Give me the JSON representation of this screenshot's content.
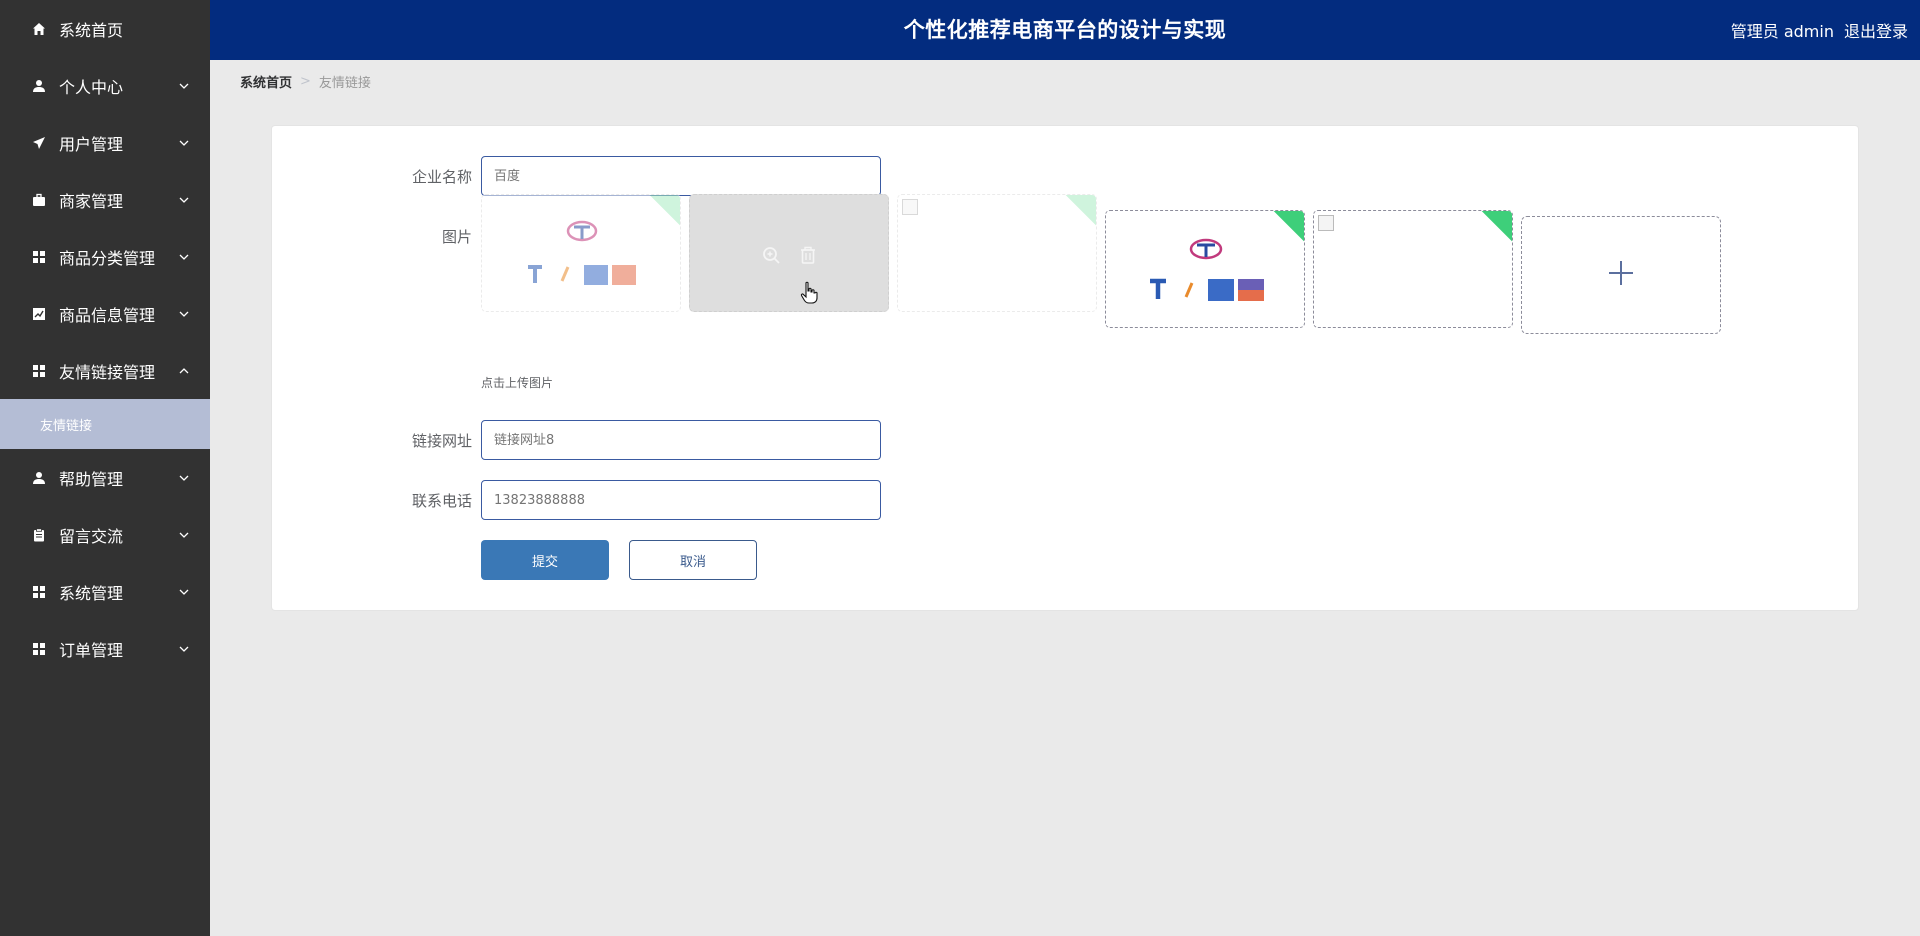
{
  "header": {
    "title": "个性化推荐电商平台的设计与实现",
    "user": "管理员 admin",
    "logout": "退出登录"
  },
  "sidebar": {
    "items": [
      {
        "label": "系统首页",
        "icon": "home-icon"
      },
      {
        "label": "个人中心",
        "icon": "user-icon"
      },
      {
        "label": "用户管理",
        "icon": "send-icon"
      },
      {
        "label": "商家管理",
        "icon": "briefcase-icon"
      },
      {
        "label": "商品分类管理",
        "icon": "grid-icon"
      },
      {
        "label": "商品信息管理",
        "icon": "chart-icon"
      },
      {
        "label": "友情链接管理",
        "icon": "grid-icon"
      },
      {
        "label": "帮助管理",
        "icon": "user-icon"
      },
      {
        "label": "留言交流",
        "icon": "clipboard-icon"
      },
      {
        "label": "系统管理",
        "icon": "grid-icon"
      },
      {
        "label": "订单管理",
        "icon": "grid-icon"
      }
    ],
    "sub_item": "友情链接"
  },
  "breadcrumb": {
    "home": "系统首页",
    "current": "友情链接"
  },
  "form": {
    "company_label": "企业名称",
    "company_placeholder": "百度",
    "image_label": "图片",
    "upload_hint": "点击上传图片",
    "url_label": "链接网址",
    "url_placeholder": "链接网址8",
    "phone_label": "联系电话",
    "phone_placeholder": "13823888888",
    "submit": "提交",
    "cancel": "取消"
  },
  "colors": {
    "header_bg": "#032c7f",
    "sidebar_bg": "#323232",
    "sub_active_bg": "#b4bdd5",
    "primary_button": "#3a78b6",
    "upload_corner": "#3ecf7a"
  }
}
